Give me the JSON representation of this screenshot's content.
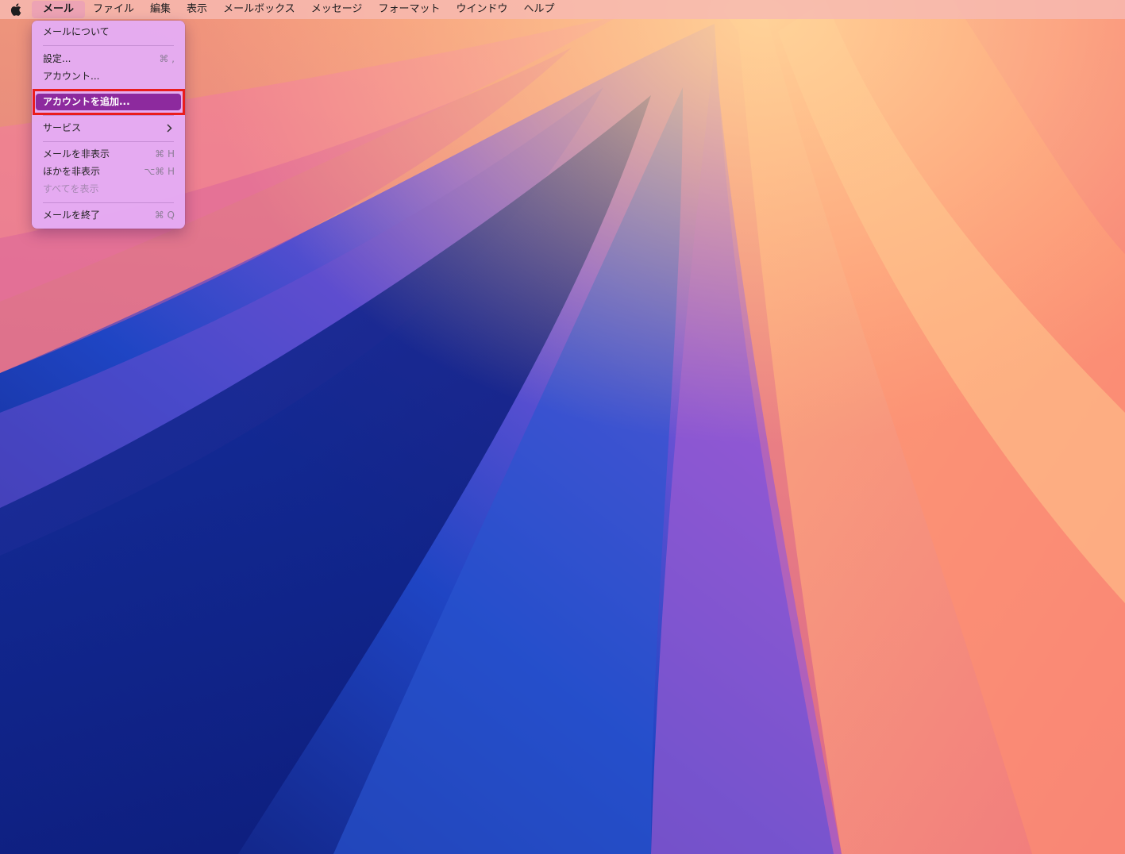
{
  "menubar": {
    "apple_icon": "apple-icon",
    "items": [
      "メール",
      "ファイル",
      "編集",
      "表示",
      "メールボックス",
      "メッセージ",
      "フォーマット",
      "ウインドウ",
      "ヘルプ"
    ]
  },
  "mail_menu": {
    "about": "メールについて",
    "settings": {
      "label": "設定...",
      "shortcut": "⌘ ,"
    },
    "accounts": "アカウント...",
    "add_account": "アカウントを追加...",
    "services": "サービス",
    "hide_mail": {
      "label": "メールを非表示",
      "shortcut": "⌘ H"
    },
    "hide_others": {
      "label": "ほかを非表示",
      "shortcut": "⌥⌘ H"
    },
    "show_all": "すべてを表示",
    "quit": {
      "label": "メールを終了",
      "shortcut": "⌘ Q"
    }
  },
  "highlight": {
    "target": "add_account",
    "color": "#ea1c1c"
  }
}
